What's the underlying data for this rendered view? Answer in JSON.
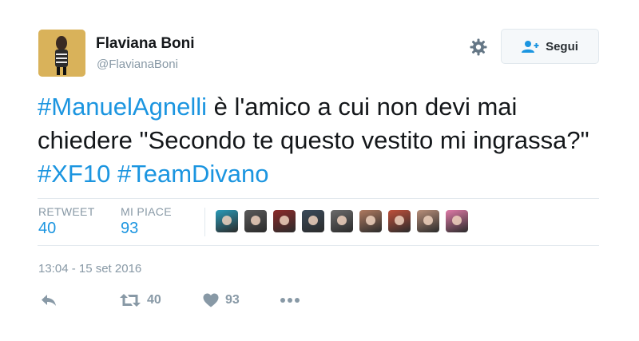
{
  "user": {
    "name": "Flaviana Boni",
    "handle": "@FlavianaBoni",
    "follow_label": "Segui"
  },
  "tweet": {
    "segments": [
      {
        "text": "#ManuelAgnelli",
        "type": "hashtag"
      },
      {
        "text": " è l'amico a cui non devi mai chiedere \"Secondo te questo vestito mi ingrassa?\" ",
        "type": "text"
      },
      {
        "text": "#XF10",
        "type": "hashtag"
      },
      {
        "text": " ",
        "type": "text"
      },
      {
        "text": "#TeamDivano",
        "type": "hashtag"
      }
    ]
  },
  "stats": {
    "retweet_label": "RETWEET",
    "retweet_count": "40",
    "likes_label": "MI PIACE",
    "likes_count": "93"
  },
  "likers": [
    {
      "color": "#2a9bb8"
    },
    {
      "color": "#5a5a5a"
    },
    {
      "color": "#8c2a2a"
    },
    {
      "color": "#3a4a5a"
    },
    {
      "color": "#6b6b6b"
    },
    {
      "color": "#b07a60"
    },
    {
      "color": "#c0503a"
    },
    {
      "color": "#b98f7a"
    },
    {
      "color": "#e07aa8"
    }
  ],
  "timestamp": "13:04 - 15 set 2016",
  "actions": {
    "retweet_count": "40",
    "like_count": "93"
  },
  "colors": {
    "link": "#1b95e0",
    "muted": "#8899a6"
  },
  "icons": [
    "gear-icon",
    "add-user-icon",
    "reply-icon",
    "retweet-icon",
    "heart-icon",
    "more-icon"
  ]
}
